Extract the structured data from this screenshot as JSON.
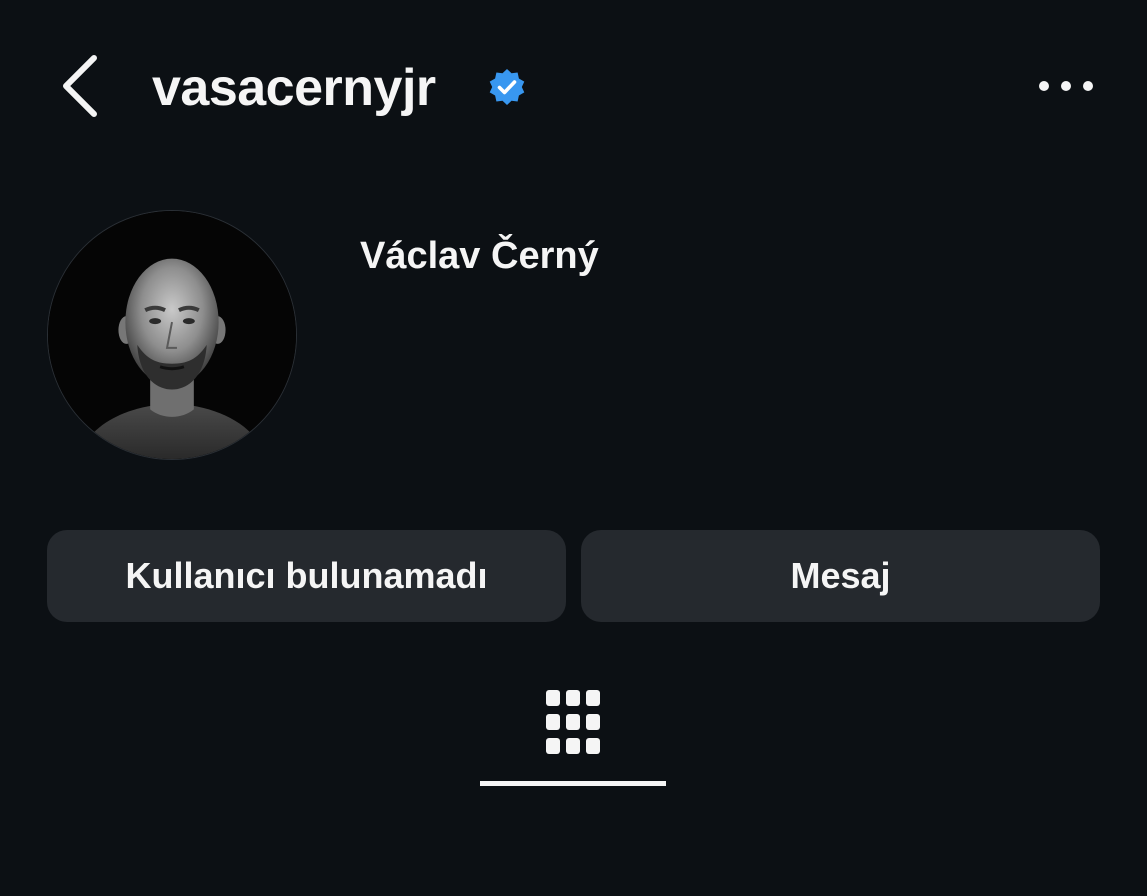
{
  "header": {
    "back_icon": "chevron-left-icon",
    "username": "vasacernyjr",
    "verified_icon": "verified-badge-icon",
    "verified_color": "#3897f0",
    "more_icon": "more-horizontal-icon"
  },
  "profile": {
    "display_name": "Václav Černý",
    "avatar": "profile-photo"
  },
  "actions": {
    "status_label": "Kullanıcı bulunamadı",
    "message_label": "Mesaj"
  },
  "tabs": {
    "active_icon": "grid-icon"
  },
  "colors": {
    "background": "#0c1014",
    "button_bg": "#25292e",
    "text": "#f5f5f5"
  }
}
